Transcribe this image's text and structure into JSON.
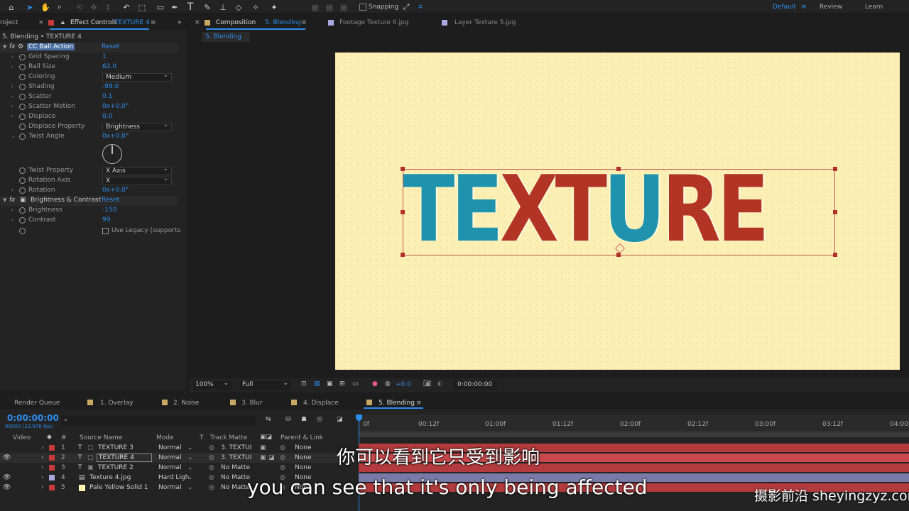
{
  "toolbar": {
    "snapping_label": "Snapping",
    "workspaces": [
      "Default",
      "Review",
      "Learn"
    ]
  },
  "left_panel": {
    "project_tab": "roject",
    "effect_controls_prefix": "Effect Controls",
    "effect_controls_layer": "TEXTURE 4",
    "breadcrumb": "5. Blending • TEXTURE 4",
    "effect1": {
      "name": "CC Ball Action",
      "reset": "Reset",
      "params": [
        {
          "label": "Grid Spacing",
          "value": "1"
        },
        {
          "label": "Ball Size",
          "value": "62.0"
        },
        {
          "label": "Coloring",
          "value": "Medium"
        },
        {
          "label": "Shading",
          "value": "-99.0"
        },
        {
          "label": "Scatter",
          "value": "0.1"
        },
        {
          "label": "Scatter Motion",
          "value": "0x+0.0°"
        },
        {
          "label": "Displace",
          "value": "0.0"
        },
        {
          "label": "Displace Property",
          "value": "Brightness"
        },
        {
          "label": "Twist Angle",
          "value": "0x+0.0°"
        },
        {
          "label": "Twist Property",
          "value": "X Axis"
        },
        {
          "label": "Rotation Axis",
          "value": "X"
        },
        {
          "label": "Rotation",
          "value": "0x+0.0°"
        }
      ]
    },
    "effect2": {
      "name": "Brightness & Contrast",
      "reset": "Reset",
      "params": [
        {
          "label": "Brightness",
          "value": "-150"
        },
        {
          "label": "Contrast",
          "value": "99"
        }
      ],
      "legacy_label": "Use Legacy (supports"
    }
  },
  "comp_panel": {
    "tabs": [
      {
        "prefix": "Composition",
        "name": "5. Blending"
      },
      {
        "prefix": "Footage",
        "name": "Texture 6.jpg"
      },
      {
        "prefix": "Layer",
        "name": "Texture 5.jpg"
      }
    ],
    "sub_tab": "5. Blending",
    "canvas_text": "TEXTURE",
    "zoom": "100%",
    "resolution": "Full",
    "exposure": "+0.0",
    "timecode": "0:00:00:00"
  },
  "timeline": {
    "tabs": [
      "Render Queue",
      "1. Overlay",
      "2. Noise",
      "3. Blur",
      "4. Displace",
      "5. Blending"
    ],
    "timecode": "0:00:00:00",
    "frame_info": "00000 (23.976 fps)",
    "col_headers": {
      "video": "Video",
      "num": "#",
      "source": "Source Name",
      "mode": "Mode",
      "t": "T",
      "matte": "Track Matte",
      "parent": "Parent & Link"
    },
    "ruler": [
      "0f",
      "00:12f",
      "01:00f",
      "01:12f",
      "02:00f",
      "02:12f",
      "03:00f",
      "03:12f",
      "04:00f"
    ],
    "layers": [
      {
        "num": "1",
        "type": "T",
        "name": "TEXTURE 3",
        "mode": "Normal",
        "matte": "3. TEXTUI",
        "parent": "None",
        "color": "#c63a3a"
      },
      {
        "num": "2",
        "type": "T",
        "name": "TEXTURE 4",
        "mode": "Normal",
        "matte": "3. TEXTUI",
        "parent": "None",
        "color": "#c63a3a"
      },
      {
        "num": "3",
        "type": "T",
        "name": "TEXTURE 2",
        "mode": "Normal",
        "matte": "No Matte",
        "parent": "None",
        "color": "#c63a3a"
      },
      {
        "num": "4",
        "type": "img",
        "name": "Texture 4.jpg",
        "mode": "Hard Ligh",
        "matte": "No Matte",
        "parent": "None",
        "color": "#a9a9e0"
      },
      {
        "num": "5",
        "type": "solid",
        "name": "Pale Yellow Solid 1",
        "mode": "Normal",
        "matte": "No Matte",
        "parent": "None",
        "color": "#fff3b0"
      }
    ]
  },
  "subtitles": {
    "zh": "你可以看到它只受到影响",
    "en": "you can see that it's only being affected"
  },
  "watermark": "摄影前沿 sheyingzyz.com"
}
